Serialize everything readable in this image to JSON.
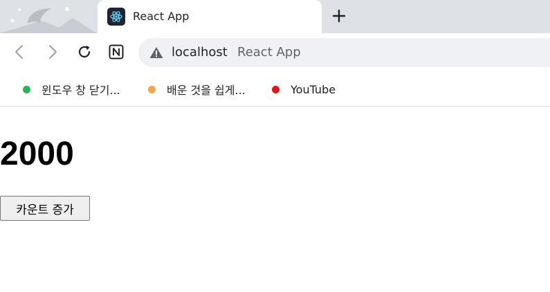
{
  "browser": {
    "tab": {
      "title": "React App",
      "favicon": "react-logo-icon"
    },
    "new_tab_icon": "plus-icon",
    "toolbar": {
      "back_icon": "back-arrow-icon",
      "forward_icon": "forward-arrow-icon",
      "reload_icon": "reload-icon",
      "extension_icon": "notion-icon"
    },
    "address_bar": {
      "security_icon": "warning-icon",
      "host": "localhost",
      "page_title": "React App"
    },
    "bookmarks": [
      {
        "label": "윈도우 창 닫기...",
        "color": "#1db954"
      },
      {
        "label": "배운 것을 쉽게...",
        "color": "#f4a742"
      },
      {
        "label": "YouTube",
        "color": "#ee1111"
      }
    ]
  },
  "page": {
    "count": "2000",
    "button_label": "카운트 증가"
  }
}
